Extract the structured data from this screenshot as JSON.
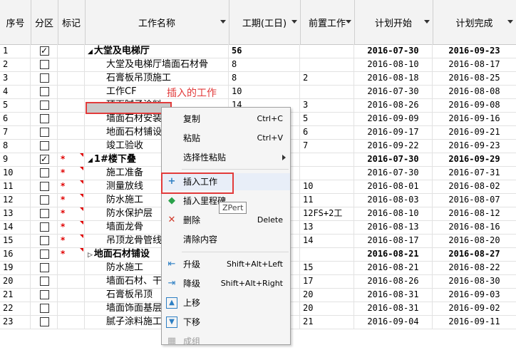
{
  "header": {
    "seq": "序号",
    "part": "分区",
    "mark": "标记",
    "name": "工作名称",
    "duration": "工期(工日)",
    "predecessor": "前置工作",
    "start": "计划开始",
    "end": "计划完成"
  },
  "rows": [
    {
      "seq": "1",
      "checked": true,
      "star": false,
      "name": "大堂及电梯厅",
      "dur": "56",
      "pre": "",
      "start": "2016-07-30",
      "end": "2016-09-23",
      "bold": true,
      "group": true
    },
    {
      "seq": "2",
      "checked": false,
      "star": false,
      "name": "大堂及电梯厅墙面石材骨",
      "dur": "8",
      "pre": "",
      "start": "2016-08-10",
      "end": "2016-08-17"
    },
    {
      "seq": "3",
      "checked": false,
      "star": false,
      "name": "石膏板吊顶施工",
      "dur": "8",
      "pre": "2",
      "start": "2016-08-18",
      "end": "2016-08-25"
    },
    {
      "seq": "4",
      "checked": false,
      "star": false,
      "name": "工作CF",
      "dur": "10",
      "pre": "",
      "start": "2016-07-30",
      "end": "2016-08-08"
    },
    {
      "seq": "5",
      "checked": false,
      "star": false,
      "name": "顶面腻子涂料",
      "dur": "14",
      "pre": "3",
      "start": "2016-08-26",
      "end": "2016-09-08"
    },
    {
      "seq": "6",
      "checked": false,
      "star": false,
      "name": "墙面石材安装",
      "dur": "8",
      "pre": "5",
      "start": "2016-09-09",
      "end": "2016-09-16"
    },
    {
      "seq": "7",
      "checked": false,
      "star": false,
      "name": "地面石材铺设",
      "dur": "5",
      "pre": "6",
      "start": "2016-09-17",
      "end": "2016-09-21"
    },
    {
      "seq": "8",
      "checked": false,
      "star": false,
      "name": "竣工验收",
      "dur": "2",
      "pre": "7",
      "start": "2016-09-22",
      "end": "2016-09-23"
    },
    {
      "seq": "9",
      "checked": true,
      "star": true,
      "name": "1#楼下叠",
      "dur": "",
      "pre": "",
      "start": "2016-07-30",
      "end": "2016-09-29",
      "bold": true,
      "group": true
    },
    {
      "seq": "10",
      "checked": false,
      "star": true,
      "name": "施工准备",
      "dur": "",
      "pre": "",
      "start": "2016-07-30",
      "end": "2016-07-31"
    },
    {
      "seq": "11",
      "checked": false,
      "star": true,
      "name": "测量放线",
      "dur": "",
      "pre": "10",
      "start": "2016-08-01",
      "end": "2016-08-02"
    },
    {
      "seq": "12",
      "checked": false,
      "star": true,
      "name": "防水施工",
      "dur": "",
      "pre": "11",
      "start": "2016-08-03",
      "end": "2016-08-07"
    },
    {
      "seq": "13",
      "checked": false,
      "star": true,
      "name": "防水保护层",
      "dur": "",
      "pre": "12FS+2工",
      "start": "2016-08-10",
      "end": "2016-08-12"
    },
    {
      "seq": "14",
      "checked": false,
      "star": true,
      "name": "墙面龙骨",
      "dur": "",
      "pre": "13",
      "start": "2016-08-13",
      "end": "2016-08-16"
    },
    {
      "seq": "15",
      "checked": false,
      "star": true,
      "name": "吊顶龙骨管线",
      "dur": "",
      "pre": "14",
      "start": "2016-08-17",
      "end": "2016-08-20"
    },
    {
      "seq": "16",
      "checked": false,
      "star": true,
      "name": "地面石材铺设",
      "dur": "",
      "pre": "",
      "start": "2016-08-21",
      "end": "2016-08-27",
      "bold": true,
      "group": true,
      "collapsed": true
    },
    {
      "seq": "19",
      "checked": false,
      "star": false,
      "name": "防水施工",
      "dur": "",
      "pre": "15",
      "start": "2016-08-21",
      "end": "2016-08-22"
    },
    {
      "seq": "20",
      "checked": false,
      "star": false,
      "name": "墙面石材、干挂",
      "dur": "",
      "pre": "17",
      "start": "2016-08-26",
      "end": "2016-08-30"
    },
    {
      "seq": "21",
      "checked": false,
      "star": false,
      "name": "石膏板吊顶",
      "dur": "",
      "pre": "20",
      "start": "2016-08-31",
      "end": "2016-09-03"
    },
    {
      "seq": "22",
      "checked": false,
      "star": false,
      "name": "墙面饰面基层",
      "dur": "",
      "pre": "20",
      "start": "2016-08-31",
      "end": "2016-09-02"
    },
    {
      "seq": "23",
      "checked": false,
      "star": false,
      "name": "腻子涂料施工",
      "dur": "",
      "pre": "21",
      "start": "2016-09-04",
      "end": "2016-09-11"
    }
  ],
  "callout": "插入的工作",
  "menu": {
    "copy": "复制",
    "copy_sc": "Ctrl+C",
    "paste": "粘贴",
    "paste_sc": "Ctrl+V",
    "paste_special": "选择性粘贴",
    "insert_task": "插入工作",
    "insert_milestone": "插入里程碑",
    "delete": "删除",
    "delete_sc": "Delete",
    "clear": "清除内容",
    "upgrade": "升级",
    "upgrade_sc": "Shift+Alt+Left",
    "downgrade": "降级",
    "downgrade_sc": "Shift+Alt+Right",
    "move_up": "上移",
    "move_down": "下移",
    "group": "成组"
  },
  "tooltip": "ZPert",
  "colors": {
    "accent_red": "#e23b3b",
    "star_red": "#e00000"
  }
}
